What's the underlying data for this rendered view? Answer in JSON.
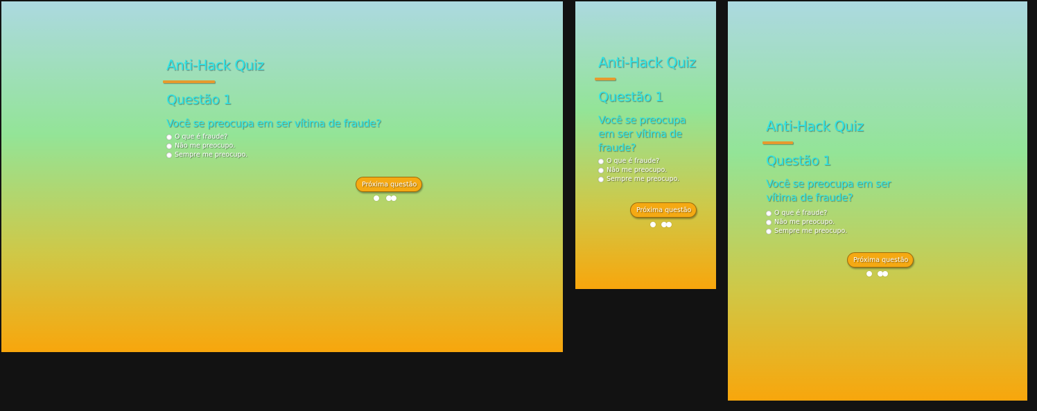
{
  "quiz": {
    "title": "Anti-Hack Quiz",
    "question_number": "Questão 1",
    "question_text": "Você se preocupa em ser vítima de fraude?",
    "options": [
      "O que é fraude?",
      "Não me preocupo.",
      "Sempre me preocupo."
    ],
    "next_button": "Próxima questão",
    "progress_dots": 3
  },
  "colors": {
    "page_background": "#121212",
    "gradient_top": "#acd9e0",
    "gradient_middle": "#93e497",
    "gradient_bottom": "#f8a60c",
    "heading_color": "#2fe4e6",
    "accent": "#e69a2e",
    "button": "#f5a913"
  }
}
